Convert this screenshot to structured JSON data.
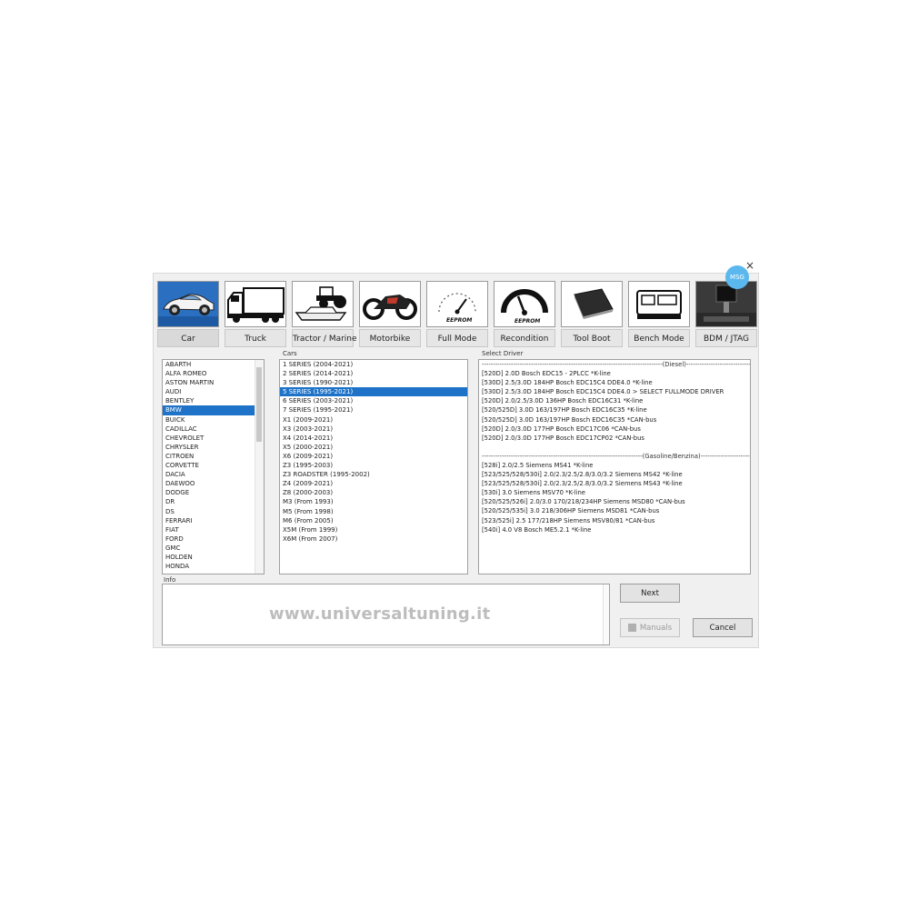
{
  "window": {
    "badge": "MSG",
    "close_glyph": "×"
  },
  "toolbar": [
    {
      "label": "Car",
      "icon": "car-icon",
      "active": true
    },
    {
      "label": "Truck",
      "icon": "truck-icon"
    },
    {
      "label": "Tractor / Marine",
      "icon": "tractor-marine-icon"
    },
    {
      "label": "Motorbike",
      "icon": "motorbike-icon"
    },
    {
      "label": "Full Mode",
      "icon": "gauge-eeprom-icon"
    },
    {
      "label": "Recondition",
      "icon": "gauge-recondition-icon"
    },
    {
      "label": "Tool Boot",
      "icon": "chip-icon"
    },
    {
      "label": "Bench Mode",
      "icon": "ecu-icon"
    },
    {
      "label": "BDM / JTAG",
      "icon": "bdm-probe-icon"
    }
  ],
  "brands": {
    "selected": "BMW",
    "items": [
      "ABARTH",
      "ALFA ROMEO",
      "ASTON MARTIN",
      "AUDI",
      "BENTLEY",
      "BMW",
      "BUICK",
      "CADILLAC",
      "CHEVROLET",
      "CHRYSLER",
      "CITROEN",
      "CORVETTE",
      "DACIA",
      "DAEWOO",
      "DODGE",
      "DR",
      "DS",
      "FERRARI",
      "FIAT",
      "FORD",
      "GMC",
      "HOLDEN",
      "HONDA"
    ]
  },
  "cars": {
    "title": "Cars",
    "selected": "5 SERIES  (1995-2021)",
    "items": [
      "1 SERIES  (2004-2021)",
      "2 SERIES  (2014-2021)",
      "3 SERIES  (1990-2021)",
      "5 SERIES  (1995-2021)",
      "6 SERIES  (2003-2021)",
      "7 SERIES  (1995-2021)",
      "X1  (2009-2021)",
      "X3  (2003-2021)",
      "X4  (2014-2021)",
      "X5  (2000-2021)",
      "X6  (2009-2021)",
      "Z3  (1995-2003)",
      "Z3 ROADSTER  (1995-2002)",
      "Z4  (2009-2021)",
      "Z8  (2000-2003)",
      "M3  (From 1993)",
      "M5  (From 1998)",
      "M6  (From 2005)",
      "X5M  (From 1999)",
      "X6M  (From 2007)"
    ]
  },
  "drivers": {
    "title": "Select Driver",
    "diesel_header": "---------------------------------------------------------------------------------(Diesel)---------------------------------------------------------------------------------",
    "diesel": [
      "[520D] 2.0D  Bosch EDC15 - 2PLCC *K-line",
      "[530D] 2.5/3.0D 184HP  Bosch EDC15C4 DDE4.0 *K-line",
      "[530D] 2.5/3.0D 184HP  Bosch EDC15C4 DDE4.0 > SELECT FULLMODE DRIVER",
      "[520D] 2.0/2.5/3.0D 136HP  Bosch EDC16C31 *K-line",
      "[520/525D] 3.0D 163/197HP  Bosch EDC16C35 *K-line",
      "[520/525D] 3.0D 163/197HP  Bosch EDC16C35 *CAN-bus",
      "[520D] 2.0/3.0D 177HP  Bosch EDC17C06 *CAN-bus",
      "[520D] 2.0/3.0D 177HP  Bosch EDC17CP02 *CAN-bus"
    ],
    "gasoline_header": "------------------------------------------------------------------------(Gasoline/Benzina)------------------------------------------------------------------------",
    "gasoline": [
      "[528i] 2.0/2.5  Siemens MS41 *K-line",
      "[523/525/528/530i] 2.0/2.3/2.5/2.8/3.0/3.2  Siemens MS42 *K-line",
      "[523/525/528/530i] 2.0/2.3/2.5/2.8/3.0/3.2  Siemens MS43 *K-line",
      "[530i] 3.0  Siemens MSV70 *K-line",
      "[520/525/526i] 2.0/3.0 170/218/234HP  Siemens MSD80 *CAN-bus",
      "[520/525/535i] 3.0 218/306HP  Siemens MSD81 *CAN-bus",
      "[523/525i] 2.5 177/218HP  Siemens MSV80/81 *CAN-bus",
      "[540i] 4.0 V8  Bosch ME5.2.1 *K-line"
    ]
  },
  "info": {
    "title": "Info",
    "text": ""
  },
  "buttons": {
    "next": "Next",
    "manuals": "Manuals",
    "cancel": "Cancel"
  },
  "watermark": "www.universaltuning.it"
}
